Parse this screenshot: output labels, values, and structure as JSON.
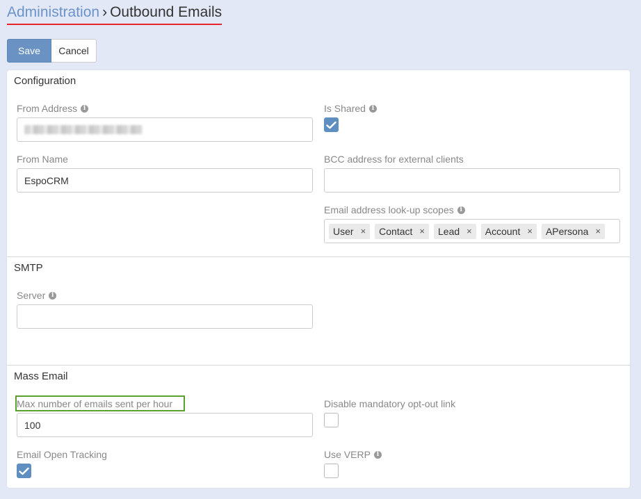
{
  "breadcrumb": {
    "root": "Administration",
    "separator": "›",
    "current": "Outbound Emails"
  },
  "toolbar": {
    "save_label": "Save",
    "cancel_label": "Cancel"
  },
  "configuration": {
    "title": "Configuration",
    "from_address": {
      "label": "From Address"
    },
    "is_shared": {
      "label": "Is Shared",
      "checked": true
    },
    "from_name": {
      "label": "From Name",
      "value": "EspoCRM"
    },
    "bcc": {
      "label": "BCC address for external clients",
      "value": ""
    },
    "lookup_scopes": {
      "label": "Email address look-up scopes",
      "tags": [
        "User",
        "Contact",
        "Lead",
        "Account",
        "APersona"
      ],
      "remove_glyph": "×"
    }
  },
  "smtp": {
    "title": "SMTP",
    "server": {
      "label": "Server",
      "value": ""
    }
  },
  "mass_email": {
    "title": "Mass Email",
    "max_per_hour": {
      "label": "Max number of emails sent per hour",
      "value": "100"
    },
    "disable_optout": {
      "label": "Disable mandatory opt-out link",
      "checked": false
    },
    "open_tracking": {
      "label": "Email Open Tracking",
      "checked": true
    },
    "use_verp": {
      "label": "Use VERP",
      "checked": false
    }
  },
  "icons": {
    "info": "i"
  },
  "colors": {
    "accent": "#6a93c3",
    "link": "#6a93c9",
    "underline": "#e8232a",
    "highlight": "#5aa02c",
    "background": "#e3e8f7"
  }
}
